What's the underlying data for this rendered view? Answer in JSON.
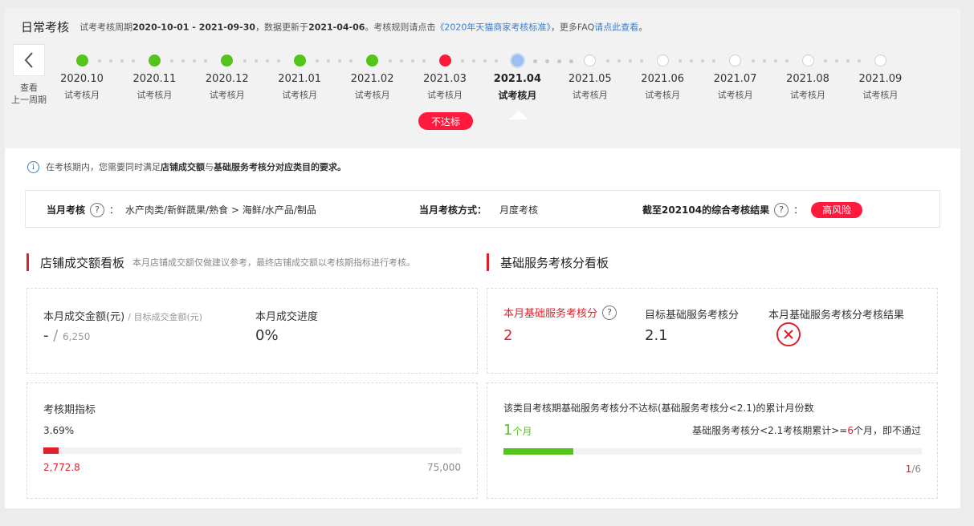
{
  "header": {
    "title": "日常考核",
    "info_prefix": "试考考核周期",
    "period": "2020-10-01 - 2021-09-30",
    "info_mid": "，数据更新于",
    "update_date": "2021-04-06",
    "info_rule": "。考核规则请点击",
    "rule_link": "《2020年天猫商家考核标准》",
    "info_faq": "，更多FAQ",
    "faq_link": "请点此查看",
    "info_end": "。"
  },
  "back": {
    "line1": "查看",
    "line2": "上一周期"
  },
  "timeline": {
    "months": [
      {
        "year": "2020.10",
        "label": "试考核月",
        "status": "green"
      },
      {
        "year": "2020.11",
        "label": "试考核月",
        "status": "green"
      },
      {
        "year": "2020.12",
        "label": "试考核月",
        "status": "green"
      },
      {
        "year": "2021.01",
        "label": "试考核月",
        "status": "green"
      },
      {
        "year": "2021.02",
        "label": "试考核月",
        "status": "green"
      },
      {
        "year": "2021.03",
        "label": "试考核月",
        "status": "red"
      },
      {
        "year": "2021.04",
        "label": "试考核月",
        "status": "current"
      },
      {
        "year": "2021.05",
        "label": "试考核月",
        "status": "empty"
      },
      {
        "year": "2021.06",
        "label": "试考核月",
        "status": "empty"
      },
      {
        "year": "2021.07",
        "label": "试考核月",
        "status": "empty"
      },
      {
        "year": "2021.08",
        "label": "试考核月",
        "status": "empty"
      },
      {
        "year": "2021.09",
        "label": "试考核月",
        "status": "empty"
      }
    ],
    "fail_badge": "不达标"
  },
  "note": {
    "prefix": "在考核期内，您需要同时满足",
    "bold1": "店铺成交额",
    "mid": "与",
    "bold2": "基础服务考核分对应类目的要求。"
  },
  "summary": {
    "monthly_label": "当月考核",
    "category": "水产肉类/新鲜蔬果/熟食 > 海鲜/水产品/制品",
    "method_label": "当月考核方式：",
    "method_value": "月度考核",
    "result_label": "截至202104的综合考核结果",
    "result_badge": "高风险",
    "colon": "："
  },
  "gmv_board": {
    "title": "店铺成交额看板",
    "subtitle": "本月店铺成交额仅做建议参考，最终店铺成交额以考核期指标进行考核。",
    "monthly_amount_label": "本月成交金额(元)",
    "target_amount_label": "/ 目标成交金额(元)",
    "monthly_amount": "-",
    "slash": "/",
    "target_amount": "6,250",
    "progress_label": "本月成交进度",
    "progress_value": "0%",
    "period_index_label": "考核期指标",
    "period_percent": "3.69%",
    "period_progress": 0.0369,
    "period_current": "2,772.8",
    "period_target": "75,000"
  },
  "service_board": {
    "title": "基础服务考核分看板",
    "score_label": "本月基础服务考核分",
    "score_value": "2",
    "target_label": "目标基础服务考核分",
    "target_value": "2.1",
    "result_label": "本月基础服务考核分考核结果",
    "months_label": "该类目考核期基础服务考核分不达标(基础服务考核分<2.1)的累计月份数",
    "months_value": "1",
    "months_unit": "个月",
    "rule_prefix": "基础服务考核分<2.1考核期累计>=",
    "rule_num": "6",
    "rule_suffix": "个月，即不通过",
    "months_progress": 0.1667,
    "count_current": "1",
    "count_total": "/6"
  },
  "colors": {
    "green": "#52c41a",
    "red": "#ff1a3d",
    "accent_red": "#e0212b",
    "link_blue": "#3b7fcf"
  }
}
